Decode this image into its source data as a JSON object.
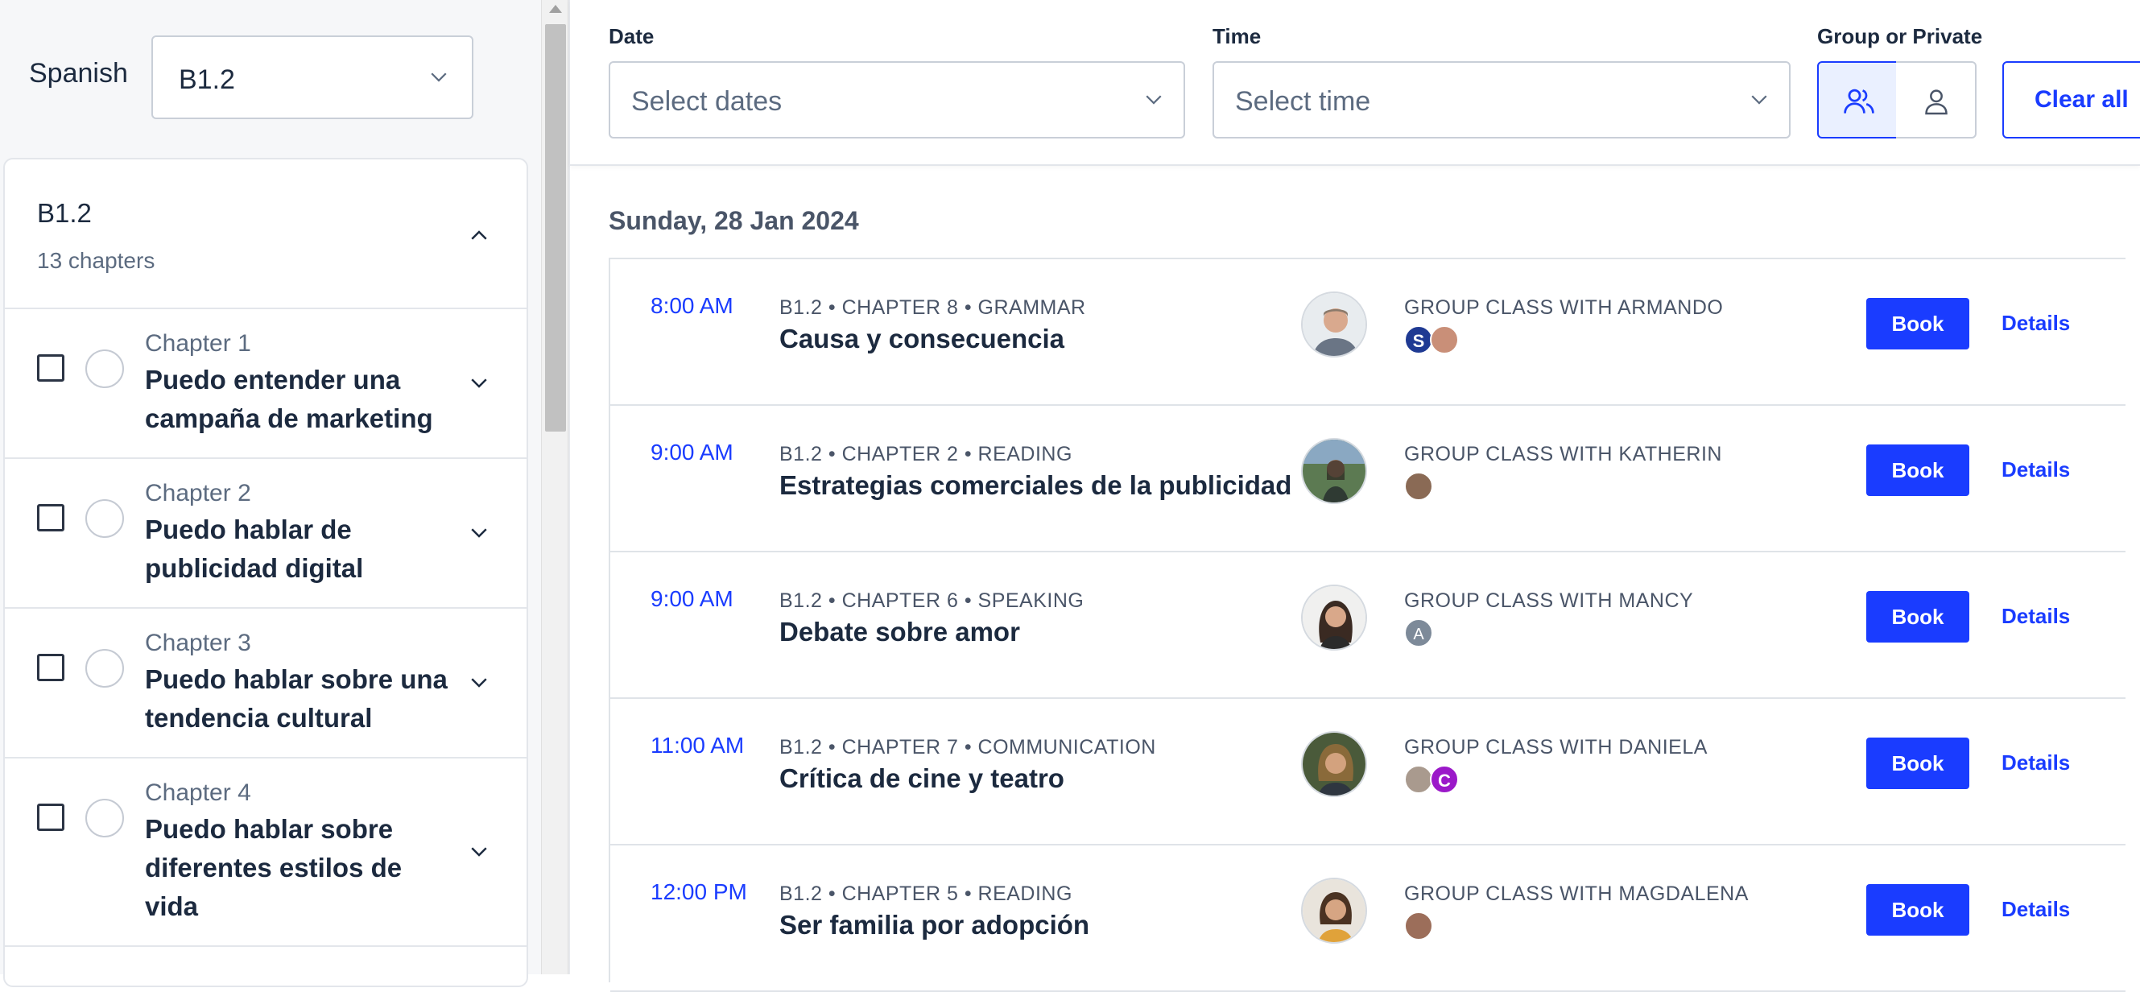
{
  "sidebar": {
    "language_label": "Spanish",
    "level_value": "B1.2",
    "card": {
      "title": "B1.2",
      "subtitle": "13 chapters",
      "chapters": [
        {
          "number": "Chapter 1",
          "title": "Puedo entender una campaña de marketing"
        },
        {
          "number": "Chapter 2",
          "title": "Puedo hablar de publicidad digital"
        },
        {
          "number": "Chapter 3",
          "title": "Puedo hablar sobre una tendencia cultural"
        },
        {
          "number": "Chapter 4",
          "title": "Puedo hablar sobre diferentes estilos de vida"
        }
      ]
    }
  },
  "filters": {
    "date": {
      "label": "Date",
      "placeholder": "Select dates"
    },
    "time": {
      "label": "Time",
      "placeholder": "Select time"
    },
    "type": {
      "label": "Group or Private",
      "selected": "group"
    },
    "clear_label": "Clear all"
  },
  "schedule": {
    "day_title": "Sunday, 28 Jan 2024",
    "book_label": "Book",
    "details_label": "Details",
    "sessions": [
      {
        "time": "8:00 AM",
        "meta": "B1.2 • CHAPTER 8 • GRAMMAR",
        "title": "Causa y consecuencia",
        "with": "GROUP CLASS WITH ARMANDO",
        "attendees": [
          {
            "initial": "S",
            "color": "#1f3a93"
          },
          {
            "initial": "",
            "color": "#c98f78"
          }
        ]
      },
      {
        "time": "9:00 AM",
        "meta": "B1.2 • CHAPTER 2 • READING",
        "title": "Estrategias comerciales de la publicidad",
        "with": "GROUP CLASS WITH KATHERIN",
        "attendees": [
          {
            "initial": "",
            "color": "#8a6a55"
          }
        ]
      },
      {
        "time": "9:00 AM",
        "meta": "B1.2 • CHAPTER 6 • SPEAKING",
        "title": "Debate sobre amor",
        "with": "GROUP CLASS WITH MANCY",
        "attendees": [
          {
            "initial": "A",
            "color": "#7d8a99"
          }
        ]
      },
      {
        "time": "11:00 AM",
        "meta": "B1.2 • CHAPTER 7 • COMMUNICATION",
        "title": "Crítica de cine y teatro",
        "with": "GROUP CLASS WITH DANIELA",
        "attendees": [
          {
            "initial": "",
            "color": "#a99a8e"
          },
          {
            "initial": "C",
            "color": "#9b19c9"
          }
        ]
      },
      {
        "time": "12:00 PM",
        "meta": "B1.2 • CHAPTER 5 • READING",
        "title": "Ser familia por adopción",
        "with": "GROUP CLASS WITH MAGDALENA",
        "attendees": [
          {
            "initial": "",
            "color": "#9c6e5a"
          }
        ]
      }
    ]
  },
  "colors": {
    "accent": "#1a3cff",
    "text": "#1c2a3f",
    "muted": "#5c6b80"
  }
}
